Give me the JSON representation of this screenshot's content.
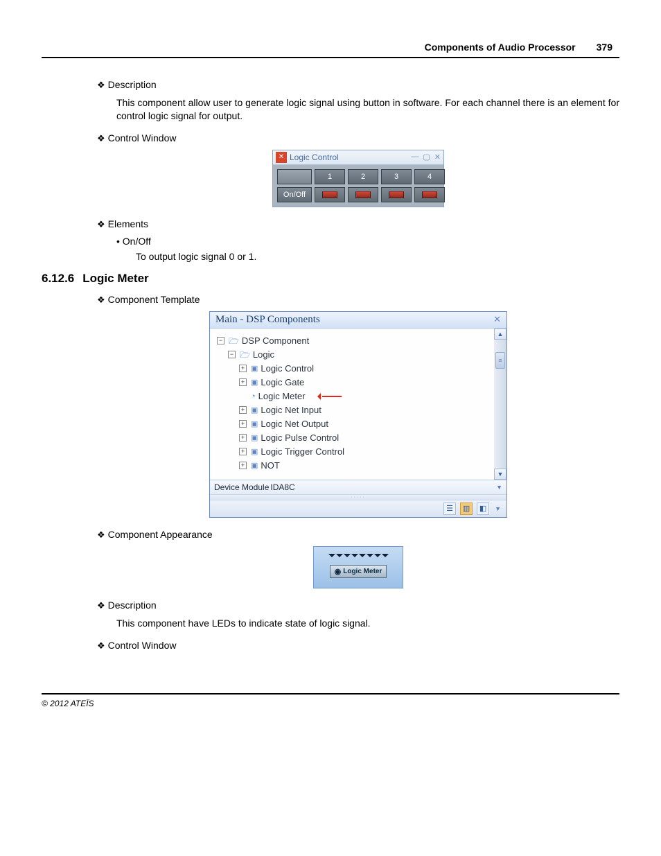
{
  "header": {
    "title": "Components of Audio Processor",
    "page": "379"
  },
  "sec1": {
    "desc_h": "Description",
    "desc_body": "This component allow user to generate logic signal using button in software. For each channel there is an element for control logic signal for output.",
    "cw_h": "Control Window",
    "elements_h": "Elements",
    "onoff_label": "On/Off",
    "onoff_body": "To output logic signal 0 or 1."
  },
  "logic_control_win": {
    "title": "Logic Control",
    "cols": [
      "1",
      "2",
      "3",
      "4"
    ],
    "row_label": "On/Off"
  },
  "sec2": {
    "num": "6.12.6",
    "title": "Logic Meter",
    "tpl_h": "Component Template",
    "app_h": "Component Appearance",
    "desc_h": "Description",
    "desc_body": "This component have LEDs to indicate state of logic signal.",
    "cw_h": "Control Window"
  },
  "dsp_win": {
    "title": "Main - DSP Components",
    "root": "DSP Component",
    "group": "Logic",
    "items": [
      "Logic Control",
      "Logic Gate",
      "Logic Meter",
      "Logic Net Input",
      "Logic Net Output",
      "Logic Pulse Control",
      "Logic Trigger Control",
      "NOT"
    ],
    "dm_label": "Device Module",
    "dm_value": "IDA8C"
  },
  "lm_block": {
    "label": "Logic Meter"
  },
  "footer": "© 2012 ATEÏS"
}
